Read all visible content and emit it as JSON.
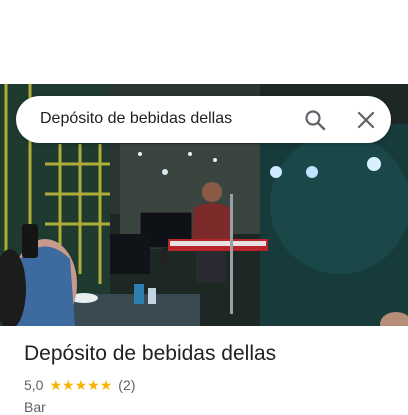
{
  "search": {
    "query": "Depósito de bebidas dellas"
  },
  "place": {
    "name": "Depósito de bebidas dellas",
    "rating": "5,0",
    "star_count": 5,
    "reviews": "(2)",
    "category": "Bar"
  },
  "icons": {
    "search": "search-icon",
    "close": "close-icon",
    "star": "star-icon"
  },
  "colors": {
    "star": "#f6b400",
    "text_primary": "#202124",
    "text_secondary": "#5f6368"
  }
}
